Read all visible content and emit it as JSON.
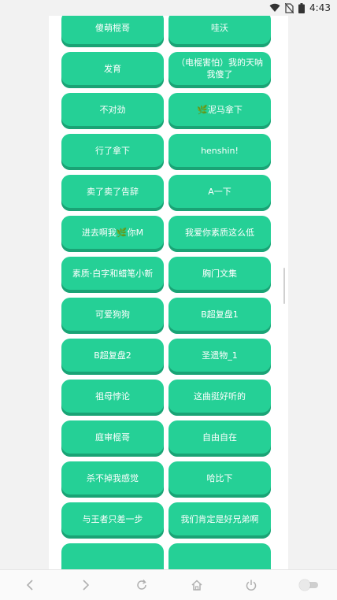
{
  "status_bar": {
    "time": "4:43",
    "icons": [
      "wifi-icon",
      "no-sim-icon",
      "battery-icon"
    ]
  },
  "buttons": [
    {
      "label": "傻萌棍哥"
    },
    {
      "label": "哇沃"
    },
    {
      "label": "发育"
    },
    {
      "label": "（电棍害怕）我的天呐我傻了"
    },
    {
      "label": "不对劲"
    },
    {
      "label": "🌿泥马拿下"
    },
    {
      "label": "行了拿下"
    },
    {
      "label": "henshin!"
    },
    {
      "label": "卖了卖了告辞"
    },
    {
      "label": "A一下"
    },
    {
      "label": "进去啊我🌿你M"
    },
    {
      "label": "我爱你素质这么低"
    },
    {
      "label": "素质·白字和蜡笔小新"
    },
    {
      "label": "胸门文集"
    },
    {
      "label": "可爱狗狗"
    },
    {
      "label": "B超复盘1"
    },
    {
      "label": "B超复盘2"
    },
    {
      "label": "圣遗物_1"
    },
    {
      "label": "祖母悖论"
    },
    {
      "label": "这曲挺好听的"
    },
    {
      "label": "庭审棍哥"
    },
    {
      "label": "自由自在"
    },
    {
      "label": "杀不掉我感觉"
    },
    {
      "label": "哈比下"
    },
    {
      "label": "与王者只差一步"
    },
    {
      "label": "我们肯定是好兄弟啊"
    },
    {
      "label": ""
    },
    {
      "label": ""
    }
  ],
  "colors": {
    "button": "#25d096",
    "button_shadow": "#1aa375",
    "background": "#f2f2f2",
    "card": "#ffffff"
  },
  "nav_bar": {
    "icons": [
      "back-icon",
      "forward-icon",
      "refresh-icon",
      "home-icon",
      "power-icon",
      "toggle-switch"
    ]
  }
}
